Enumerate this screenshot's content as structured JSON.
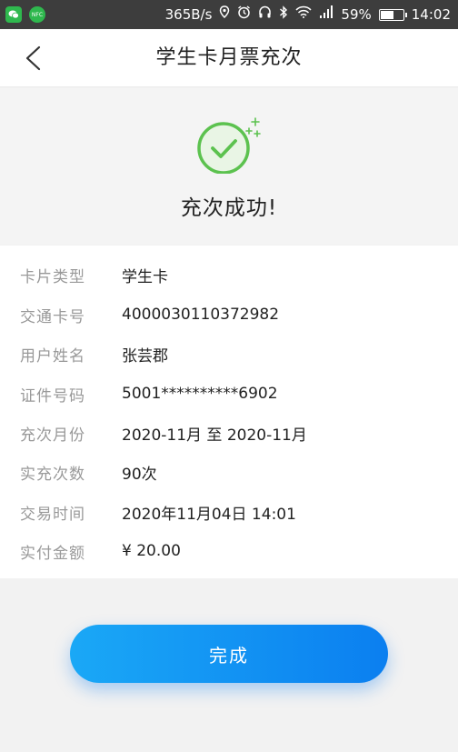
{
  "status_bar": {
    "speed": "365B/s",
    "battery": "59%",
    "battery_level": 0.59,
    "time": "14:02",
    "nfc_label": "NFC"
  },
  "nav": {
    "title": "学生卡月票充次"
  },
  "result": {
    "message": "充次成功!"
  },
  "details": [
    {
      "label": "卡片类型",
      "value": "学生卡"
    },
    {
      "label": "交通卡号",
      "value": "4000030110372982"
    },
    {
      "label": "用户姓名",
      "value": "张芸郡"
    },
    {
      "label": "证件号码",
      "value": "5001**********6902"
    },
    {
      "label": "充次月份",
      "value": "2020-11月 至 2020-11月"
    },
    {
      "label": "实充次数",
      "value": "90次"
    },
    {
      "label": "交易时间",
      "value": "2020年11月04日 14:01"
    },
    {
      "label": "实付金额",
      "value": "¥ 20.00"
    }
  ],
  "actions": {
    "done_label": "完成"
  },
  "colors": {
    "accent": "#0b7ff0",
    "success": "#5cc24f"
  }
}
